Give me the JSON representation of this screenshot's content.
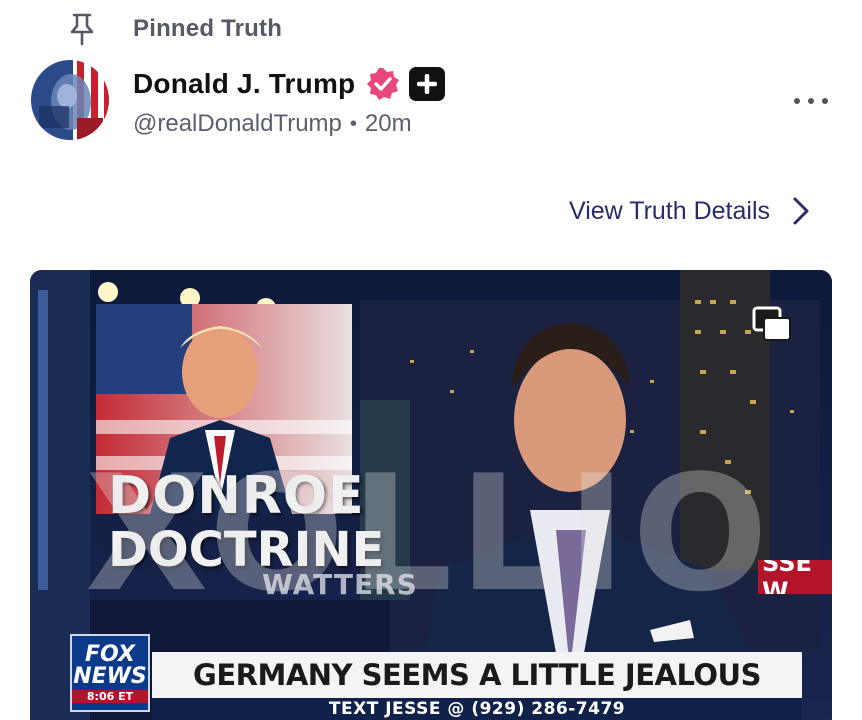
{
  "pinned": {
    "label": "Pinned Truth",
    "icon": "pin-icon"
  },
  "author": {
    "display_name": "Donald J. Trump",
    "handle": "@realDonaldTrump",
    "separator": "•",
    "time_ago": "20m",
    "verified_icon": "verified-badge-icon",
    "plus_icon": "plus-badge-icon"
  },
  "actions": {
    "more_icon": "more-dots-icon",
    "details_label": "View Truth Details",
    "details_icon": "chevron-right-icon"
  },
  "media": {
    "overlay_line1": "DONROE",
    "overlay_line2": "DOCTRINE",
    "watermark": "XOLLIO",
    "mid_tag": "WATTERS",
    "side_tag": "SSE W",
    "fox_line1": "FOX",
    "fox_line2": "NEWS",
    "fox_time": "8:06 ET",
    "headline": "GERMANY SEEMS A LITTLE JEALOUS",
    "subline": "TEXT JESSE @ (929) 286-7479",
    "multi_icon": "multiple-media-icon"
  },
  "colors": {
    "accent_link": "#2a2b6d",
    "verified_pink": "#e8467c",
    "fox_red": "#b3142a",
    "fox_blue": "#0c3a8a"
  }
}
